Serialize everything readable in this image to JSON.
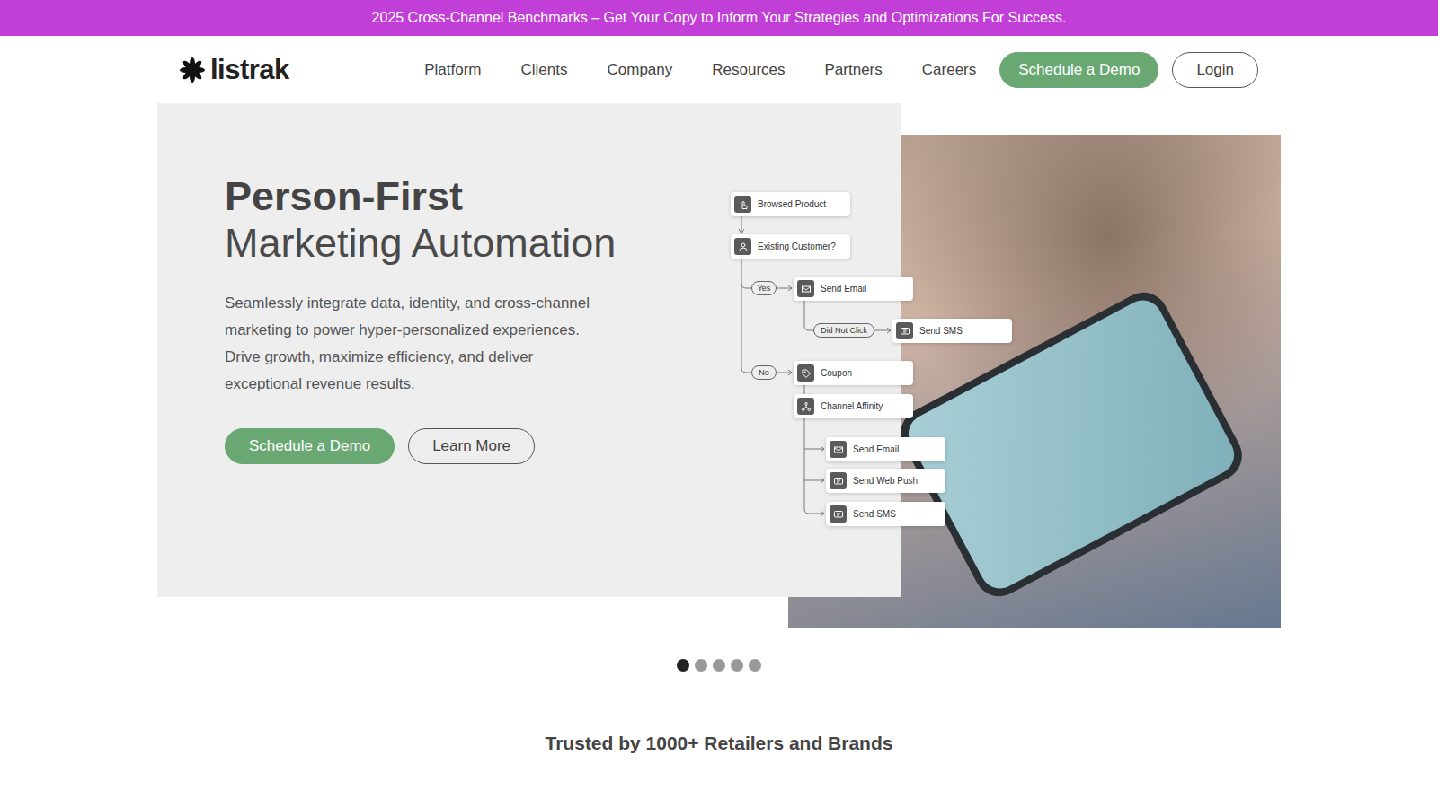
{
  "banner": {
    "text": "2025 Cross-Channel Benchmarks – Get Your Copy to Inform Your Strategies and Optimizations For Success."
  },
  "logo": {
    "text": "listrak"
  },
  "nav": {
    "links": [
      "Platform",
      "Clients",
      "Company",
      "Resources",
      "Partners",
      "Careers"
    ],
    "demo_button": "Schedule a Demo",
    "login_button": "Login"
  },
  "hero": {
    "title": "Person-First",
    "subtitle": "Marketing Automation",
    "description": "Seamlessly integrate data, identity, and cross-channel marketing to power hyper-personalized experiences. Drive growth, maximize efficiency, and deliver exceptional revenue results.",
    "buttons": [
      {
        "label": "Schedule a Demo",
        "kind": "primary"
      },
      {
        "label": "Learn More",
        "kind": "secondary"
      }
    ]
  },
  "diagram": {
    "nodes": [
      {
        "label": "Browsed Product",
        "kind": "step"
      },
      {
        "label": "Existing Customer?",
        "kind": "step"
      },
      {
        "label": "Yes",
        "kind": "branch"
      },
      {
        "label": "Send Email",
        "kind": "step"
      },
      {
        "label": "Did Not Click",
        "kind": "branch"
      },
      {
        "label": "Send SMS",
        "kind": "step"
      },
      {
        "label": "No",
        "kind": "branch"
      },
      {
        "label": "Coupon",
        "kind": "step"
      },
      {
        "label": "Channel Affinity",
        "kind": "step"
      },
      {
        "label": "Send Email",
        "kind": "step"
      },
      {
        "label": "Send Web Push",
        "kind": "step"
      },
      {
        "label": "Send SMS",
        "kind": "step"
      }
    ]
  },
  "carousel": {
    "dots": [
      {
        "selected": true
      },
      {
        "selected": false
      },
      {
        "selected": false
      },
      {
        "selected": false
      },
      {
        "selected": false
      }
    ]
  },
  "trusted": {
    "title": "Trusted by 1000+ Retailers and Brands"
  }
}
